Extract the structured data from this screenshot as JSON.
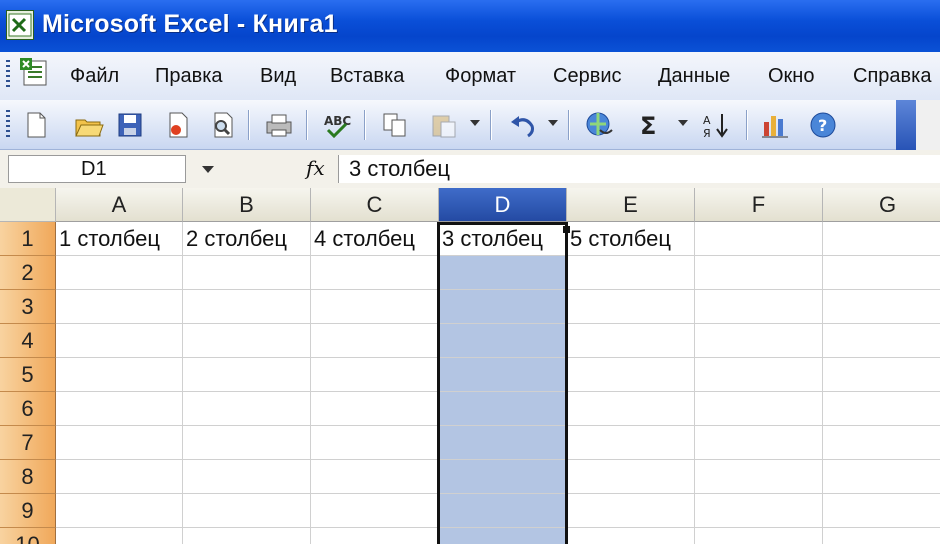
{
  "window": {
    "title": "Microsoft Excel - Книга1"
  },
  "menu": {
    "items": [
      "Файл",
      "Правка",
      "Вид",
      "Вставка",
      "Формат",
      "Сервис",
      "Данные",
      "Окно",
      "Справка"
    ]
  },
  "toolbar": {
    "icons": [
      "new-icon",
      "open-icon",
      "save-icon",
      "permission-icon",
      "print-preview-icon",
      "print-icon",
      "spelling-icon",
      "copy-icon",
      "paste-icon",
      "undo-icon",
      "hyperlink-icon",
      "autosum-icon",
      "sort-ascending-icon",
      "chart-wizard-icon",
      "help-icon"
    ]
  },
  "formula_bar": {
    "name_box": "D1",
    "fx_label": "fx",
    "formula": "3 столбец"
  },
  "sheet": {
    "columns": [
      "A",
      "B",
      "C",
      "D",
      "E",
      "F",
      "G"
    ],
    "rows": [
      "1",
      "2",
      "3",
      "4",
      "5",
      "6",
      "7",
      "8",
      "9",
      "10"
    ],
    "selected_column": "D",
    "active_cell": "D1",
    "cells": {
      "A1": "1 столбец",
      "B1": "2 столбец",
      "C1": "4 столбец",
      "D1": "3 столбец",
      "E1": "5 столбец"
    }
  },
  "colors": {
    "title_bar": "#0a4fd8",
    "selected_column_fill": "#b3c5e3",
    "selected_header": "#244aa3",
    "row_header": "#f0a85a"
  }
}
